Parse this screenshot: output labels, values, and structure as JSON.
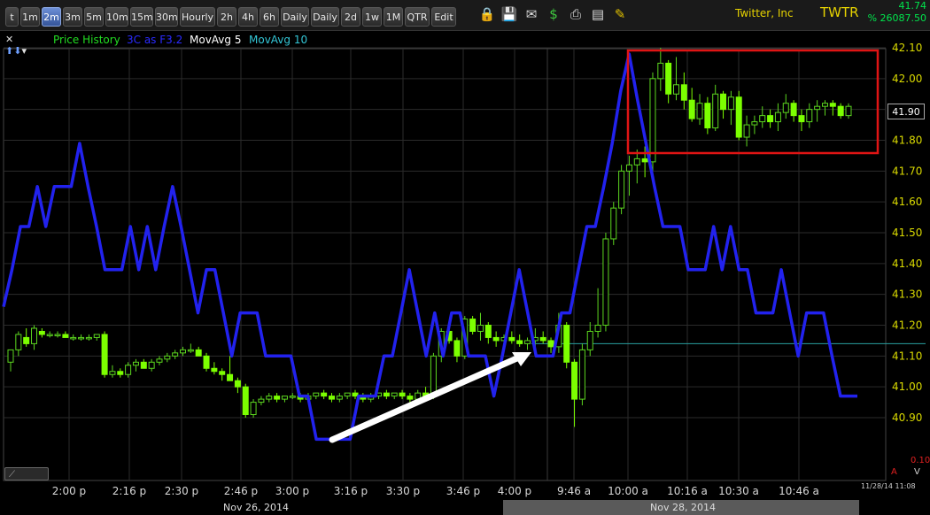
{
  "toolbar": {
    "buttons": [
      "t",
      "1m",
      "2m",
      "3m",
      "5m",
      "10m",
      "15m",
      "30m",
      "Hourly",
      "2h",
      "4h",
      "6h",
      "Daily",
      "Daily",
      "2d",
      "1w",
      "1M",
      "QTR",
      "Edit"
    ],
    "active": "2m",
    "icons": [
      "lock-icon",
      "save-icon",
      "mail-icon",
      "dollar-icon",
      "print-icon",
      "card-icon",
      "pencil-icon"
    ]
  },
  "ticker": {
    "name": "Twitter, Inc",
    "symbol": "TWTR",
    "last": "41.74",
    "change": "% 26087.50"
  },
  "legend": {
    "items": [
      {
        "label": "Price History",
        "color": "#22dd22"
      },
      {
        "label": "3C as F3.2",
        "color": "#2a2aff"
      },
      {
        "label": "MovAvg 5",
        "color": "#ffffff"
      },
      {
        "label": "MovAvg 10",
        "color": "#33c6d6"
      }
    ]
  },
  "price_tag": "41.90",
  "timestamp": "11/28/14 11:08",
  "corner_value": "0.10",
  "corner_a": "A",
  "corner_v": "V",
  "dates": {
    "left": "Nov 26, 2014",
    "right": "Nov 28, 2014"
  },
  "chart_data": {
    "type": "candlestick",
    "y_ticks": [
      "42.10",
      "42.00",
      "41.90",
      "41.80",
      "41.70",
      "41.60",
      "41.50",
      "41.40",
      "41.30",
      "41.20",
      "41.10",
      "41.00",
      "40.90"
    ],
    "ylim": [
      40.83,
      42.15
    ],
    "x_ticks": [
      "2:00 p",
      "2:16 p",
      "2:30 p",
      "2:46 p",
      "3:00 p",
      "3:16 p",
      "3:30 p",
      "3:46 p",
      "4:00 p",
      "9:46 a",
      "10:00 a",
      "10:16 a",
      "10:30 a",
      "10:46 a"
    ],
    "reference_line": 41.14,
    "colors": {
      "up": "#5cd61f",
      "up_fill": "#000000",
      "down": "#7cff00",
      "indicator": "#2222ee",
      "ref": "#2aa0a0",
      "box": "#e01414",
      "arrow": "#ffffff"
    },
    "candles": [
      [
        41.08,
        41.12,
        41.05,
        41.12
      ],
      [
        41.12,
        41.18,
        41.1,
        41.17
      ],
      [
        41.16,
        41.19,
        41.13,
        41.14
      ],
      [
        41.14,
        41.2,
        41.12,
        41.19
      ],
      [
        41.18,
        41.19,
        41.16,
        41.17
      ],
      [
        41.17,
        41.18,
        41.16,
        41.17
      ],
      [
        41.17,
        41.18,
        41.16,
        41.17
      ],
      [
        41.17,
        41.18,
        41.16,
        41.16
      ],
      [
        41.16,
        41.17,
        41.15,
        41.16
      ],
      [
        41.16,
        41.17,
        41.15,
        41.16
      ],
      [
        41.16,
        41.17,
        41.15,
        41.16
      ],
      [
        41.16,
        41.17,
        41.15,
        41.17
      ],
      [
        41.17,
        41.18,
        41.03,
        41.04
      ],
      [
        41.04,
        41.07,
        41.03,
        41.05
      ],
      [
        41.05,
        41.06,
        41.03,
        41.04
      ],
      [
        41.04,
        41.08,
        41.03,
        41.07
      ],
      [
        41.07,
        41.09,
        41.05,
        41.08
      ],
      [
        41.08,
        41.09,
        41.06,
        41.06
      ],
      [
        41.06,
        41.09,
        41.05,
        41.08
      ],
      [
        41.08,
        41.1,
        41.07,
        41.09
      ],
      [
        41.09,
        41.11,
        41.08,
        41.1
      ],
      [
        41.1,
        41.12,
        41.09,
        41.11
      ],
      [
        41.11,
        41.13,
        41.1,
        41.12
      ],
      [
        41.12,
        41.14,
        41.11,
        41.12
      ],
      [
        41.12,
        41.13,
        41.1,
        41.1
      ],
      [
        41.1,
        41.11,
        41.05,
        41.06
      ],
      [
        41.06,
        41.08,
        41.04,
        41.05
      ],
      [
        41.05,
        41.06,
        41.02,
        41.04
      ],
      [
        41.04,
        41.1,
        41.02,
        41.02
      ],
      [
        41.02,
        41.03,
        40.98,
        41.0
      ],
      [
        41.0,
        41.01,
        40.9,
        40.91
      ],
      [
        40.91,
        40.96,
        40.9,
        40.95
      ],
      [
        40.95,
        40.97,
        40.94,
        40.96
      ],
      [
        40.96,
        40.98,
        40.95,
        40.97
      ],
      [
        40.97,
        40.98,
        40.95,
        40.96
      ],
      [
        40.96,
        40.97,
        40.95,
        40.97
      ],
      [
        40.97,
        40.98,
        40.96,
        40.97
      ],
      [
        40.97,
        40.98,
        40.95,
        40.96
      ],
      [
        40.96,
        40.98,
        40.95,
        40.97
      ],
      [
        40.97,
        40.98,
        40.96,
        40.98
      ],
      [
        40.98,
        40.99,
        40.96,
        40.97
      ],
      [
        40.97,
        40.98,
        40.95,
        40.96
      ],
      [
        40.96,
        40.98,
        40.95,
        40.97
      ],
      [
        40.97,
        40.98,
        40.96,
        40.98
      ],
      [
        40.98,
        40.99,
        40.96,
        40.97
      ],
      [
        40.97,
        40.98,
        40.95,
        40.96
      ],
      [
        40.96,
        40.98,
        40.95,
        40.97
      ],
      [
        40.97,
        40.98,
        40.96,
        40.98
      ],
      [
        40.98,
        40.99,
        40.96,
        40.97
      ],
      [
        40.97,
        40.98,
        40.96,
        40.98
      ],
      [
        40.98,
        40.99,
        40.96,
        40.97
      ],
      [
        40.97,
        40.98,
        40.95,
        40.96
      ],
      [
        40.96,
        40.99,
        40.95,
        40.98
      ],
      [
        40.98,
        41.0,
        40.96,
        40.97
      ],
      [
        40.97,
        41.11,
        40.96,
        41.1
      ],
      [
        41.1,
        41.19,
        41.08,
        41.18
      ],
      [
        41.18,
        41.19,
        41.14,
        41.15
      ],
      [
        41.15,
        41.16,
        41.08,
        41.1
      ],
      [
        41.1,
        41.23,
        41.09,
        41.22
      ],
      [
        41.22,
        41.23,
        41.17,
        41.18
      ],
      [
        41.18,
        41.24,
        41.15,
        41.2
      ],
      [
        41.2,
        41.21,
        41.14,
        41.16
      ],
      [
        41.16,
        41.18,
        41.13,
        41.15
      ],
      [
        41.15,
        41.17,
        41.13,
        41.16
      ],
      [
        41.16,
        41.18,
        41.14,
        41.15
      ],
      [
        41.15,
        41.17,
        41.13,
        41.14
      ],
      [
        41.14,
        41.16,
        41.12,
        41.15
      ],
      [
        41.15,
        41.19,
        41.13,
        41.16
      ],
      [
        41.16,
        41.18,
        41.14,
        41.15
      ],
      [
        41.15,
        41.16,
        41.11,
        41.13
      ],
      [
        41.13,
        41.24,
        41.11,
        41.2
      ],
      [
        41.2,
        41.21,
        41.06,
        41.08
      ],
      [
        41.08,
        41.09,
        40.87,
        40.96
      ],
      [
        40.96,
        41.14,
        40.94,
        41.12
      ],
      [
        41.12,
        41.21,
        41.1,
        41.18
      ],
      [
        41.18,
        41.32,
        41.16,
        41.2
      ],
      [
        41.2,
        41.5,
        41.18,
        41.48
      ],
      [
        41.48,
        41.6,
        41.46,
        41.58
      ],
      [
        41.58,
        41.72,
        41.56,
        41.7
      ],
      [
        41.7,
        41.75,
        41.62,
        41.72
      ],
      [
        41.72,
        41.77,
        41.66,
        41.74
      ],
      [
        41.74,
        41.78,
        41.68,
        41.73
      ],
      [
        41.73,
        42.02,
        41.7,
        42.0
      ],
      [
        42.0,
        42.1,
        41.96,
        42.05
      ],
      [
        42.05,
        42.06,
        41.92,
        41.95
      ],
      [
        41.95,
        42.07,
        41.93,
        41.98
      ],
      [
        41.98,
        42.02,
        41.9,
        41.93
      ],
      [
        41.93,
        41.97,
        41.86,
        41.87
      ],
      [
        41.87,
        41.95,
        41.85,
        41.92
      ],
      [
        41.92,
        41.94,
        41.82,
        41.84
      ],
      [
        41.84,
        41.98,
        41.83,
        41.95
      ],
      [
        41.95,
        41.96,
        41.87,
        41.9
      ],
      [
        41.9,
        41.96,
        41.85,
        41.94
      ],
      [
        41.94,
        41.96,
        41.8,
        41.81
      ],
      [
        41.81,
        41.88,
        41.78,
        41.85
      ],
      [
        41.85,
        41.88,
        41.82,
        41.86
      ],
      [
        41.86,
        41.91,
        41.84,
        41.88
      ],
      [
        41.88,
        41.9,
        41.84,
        41.86
      ],
      [
        41.86,
        41.92,
        41.83,
        41.89
      ],
      [
        41.89,
        41.95,
        41.87,
        41.92
      ],
      [
        41.92,
        41.93,
        41.86,
        41.88
      ],
      [
        41.88,
        41.9,
        41.83,
        41.86
      ],
      [
        41.86,
        41.92,
        41.84,
        41.9
      ],
      [
        41.9,
        41.93,
        41.86,
        41.91
      ],
      [
        41.91,
        41.93,
        41.88,
        41.92
      ],
      [
        41.92,
        41.93,
        41.88,
        41.91
      ],
      [
        41.91,
        41.92,
        41.87,
        41.88
      ],
      [
        41.88,
        41.92,
        41.87,
        41.91
      ]
    ],
    "indicator_3c": [
      41.26,
      41.38,
      41.52,
      41.52,
      41.65,
      41.52,
      41.65,
      41.65,
      41.65,
      41.79,
      41.65,
      41.52,
      41.38,
      41.38,
      41.38,
      41.52,
      41.38,
      41.52,
      41.38,
      41.52,
      41.65,
      41.52,
      41.38,
      41.24,
      41.38,
      41.38,
      41.24,
      41.1,
      41.24,
      41.24,
      41.24,
      41.1,
      41.1,
      41.1,
      41.1,
      40.97,
      40.97,
      40.83,
      40.83,
      40.83,
      40.83,
      40.83,
      40.97,
      40.97,
      40.97,
      41.1,
      41.1,
      41.24,
      41.38,
      41.24,
      41.1,
      41.24,
      41.1,
      41.24,
      41.24,
      41.1,
      41.1,
      41.1,
      40.97,
      41.1,
      41.24,
      41.38,
      41.24,
      41.1,
      41.1,
      41.1,
      41.24,
      41.24,
      41.38,
      41.52,
      41.52,
      41.65,
      41.79,
      41.96,
      42.08,
      41.93,
      41.79,
      41.65,
      41.52,
      41.52,
      41.52,
      41.38,
      41.38,
      41.38,
      41.52,
      41.38,
      41.52,
      41.38,
      41.38,
      41.24,
      41.24,
      41.24,
      41.38,
      41.24,
      41.1,
      41.24,
      41.24,
      41.24,
      41.1,
      40.97,
      40.97,
      40.97
    ],
    "moving_avg_10_level": 41.14
  }
}
